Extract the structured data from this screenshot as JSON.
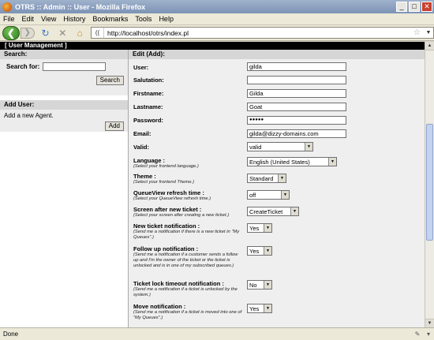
{
  "window": {
    "title": "OTRS :: Admin :: User - Mozilla Firefox",
    "min_label": "_",
    "max_label": "□",
    "close_label": "✕"
  },
  "menu": [
    "File",
    "Edit",
    "View",
    "History",
    "Bookmarks",
    "Tools",
    "Help"
  ],
  "nav": {
    "back_glyph": "❮",
    "fwd_glyph": "❯",
    "reload_glyph": "↻",
    "stop_glyph": "✕",
    "home_glyph": "⌂",
    "site_icon_text": "((",
    "url": "http://localhost/otrs/index.pl",
    "star_glyph": "☆",
    "dropdown_glyph": "▼"
  },
  "header": "[ User Management ]",
  "left": {
    "search_title": "Search:",
    "search_label": "Search for:",
    "search_value": "",
    "search_button": "Search",
    "add_title": "Add User:",
    "add_text": "Add a new Agent.",
    "add_button": "Add"
  },
  "form": {
    "title": "Edit (Add):",
    "user_label": "User:",
    "user_value": "gilda",
    "salutation_label": "Salutation:",
    "salutation_value": "",
    "firstname_label": "Firstname:",
    "firstname_value": "Gilda",
    "lastname_label": "Lastname:",
    "lastname_value": "Goat",
    "password_label": "Password:",
    "password_value": "●●●●●",
    "email_label": "Email:",
    "email_value": "gilda@dizzy-domains.com",
    "valid_label": "Valid:",
    "valid_value": "valid",
    "language_label": "Language :",
    "language_help": "(Select your frontend language.)",
    "language_value": "English (United States)",
    "theme_label": "Theme :",
    "theme_help": "(Select your frontend Theme.)",
    "theme_value": "Standard",
    "queueview_label": "QueueView refresh time :",
    "queueview_help": "(Select your QueueView refresh time.)",
    "queueview_value": "off",
    "screen_label": "Screen after new ticket :",
    "screen_help": "(Select your screen after creating a new ticket.)",
    "screen_value": "CreateTicket",
    "newticket_label": "New ticket notification :",
    "newticket_help": "(Send me a notification if there is a new ticket in \"My Queues\".)",
    "newticket_value": "Yes",
    "followup_label": "Follow up notification :",
    "followup_help": "(Send me a notification if a customer sends a follow up and I'm the owner of the ticket or the ticket is unlocked and is in one of my subscribed queues.)",
    "followup_value": "Yes",
    "lock_label": "Ticket lock timeout notification :",
    "lock_help": "(Send me a notification if a ticket is unlocked by the system.)",
    "lock_value": "No",
    "move_label": "Move notification :",
    "move_help": "(Send me a notification if a ticket is moved into one of \"My Queues\".)",
    "move_value": "Yes"
  },
  "status": {
    "text": "Done",
    "arrow_glyph": "▾",
    "addon_glyph": "✎"
  }
}
